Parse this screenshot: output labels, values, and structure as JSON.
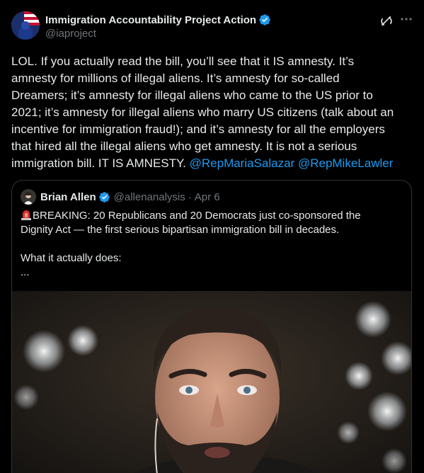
{
  "author": {
    "display_name": "Immigration Accountability Project Action",
    "handle": "@iaproject"
  },
  "tweet": {
    "line1": "LOL. If you actually read the bill, you’ll see that it IS amnesty. It’s",
    "line2": "amnesty for millions of illegal aliens. It’s amnesty for so-called",
    "line3": "Dreamers; it’s amnesty for illegal aliens who came to the US prior to",
    "line4": "2021; it’s amnesty for illegal aliens who marry US citizens (talk about an",
    "line5": "incentive for immigration fraud!); and it’s amnesty for all the employers",
    "line6": "that hired all the illegal aliens who get amnesty. It is not a serious",
    "line7": "immigration bill. IT IS AMNESTY.",
    "mention1": "@RepMariaSalazar",
    "mention2": "@RepMikeLawler"
  },
  "quote": {
    "display_name": "Brian Allen",
    "handle": "@allenanalysis",
    "separator": "·",
    "date": "Apr 6",
    "line1": "BREAKING: 20 Republicans and 20 Democrats just co-sponsored the",
    "line2": "Dignity Act — the first serious bipartisan immigration bill in decades.",
    "line3": "What it actually does:",
    "line4": "..."
  },
  "icons": {
    "verified": "verified-badge-icon",
    "grok": "grok-icon",
    "more": "more-options-icon",
    "siren": "siren-emoji-icon"
  },
  "colors": {
    "background": "#000000",
    "text": "#e7e9ea",
    "secondary": "#71767b",
    "accent": "#1d9bf0",
    "border": "#2f3336"
  }
}
